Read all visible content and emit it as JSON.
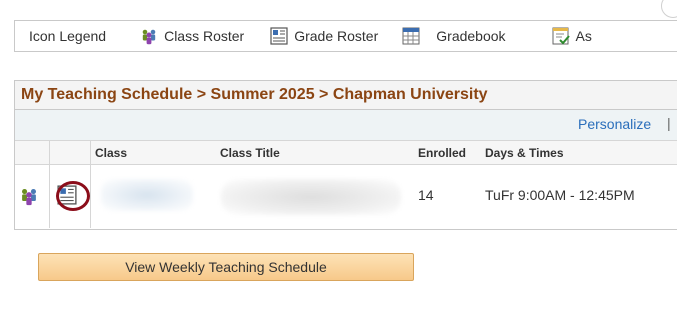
{
  "legend": {
    "title": "Icon Legend",
    "items": [
      {
        "label": "Class Roster",
        "icon": "class-roster-icon"
      },
      {
        "label": "Grade Roster",
        "icon": "grade-roster-icon"
      },
      {
        "label": "Gradebook",
        "icon": "gradebook-icon"
      },
      {
        "label": "As",
        "icon": "assignment-icon"
      }
    ]
  },
  "schedule": {
    "title": "My Teaching Schedule > Summer 2025 > Chapman University",
    "personalize_label": "Personalize",
    "personalize_separator": "|",
    "columns": {
      "class": "Class",
      "class_title": "Class Title",
      "enrolled": "Enrolled",
      "days_times": "Days & Times"
    },
    "rows": [
      {
        "class": "",
        "class_title": "",
        "enrolled": "14",
        "days_times": "TuFr 9:00AM - 12:45PM"
      }
    ]
  },
  "button": {
    "label": "View Weekly Teaching Schedule"
  },
  "colors": {
    "title_brown": "#8b4513",
    "link_blue": "#2a6ebb",
    "highlight_red": "#8b0d1a",
    "button_orange": "#f7c98a"
  }
}
